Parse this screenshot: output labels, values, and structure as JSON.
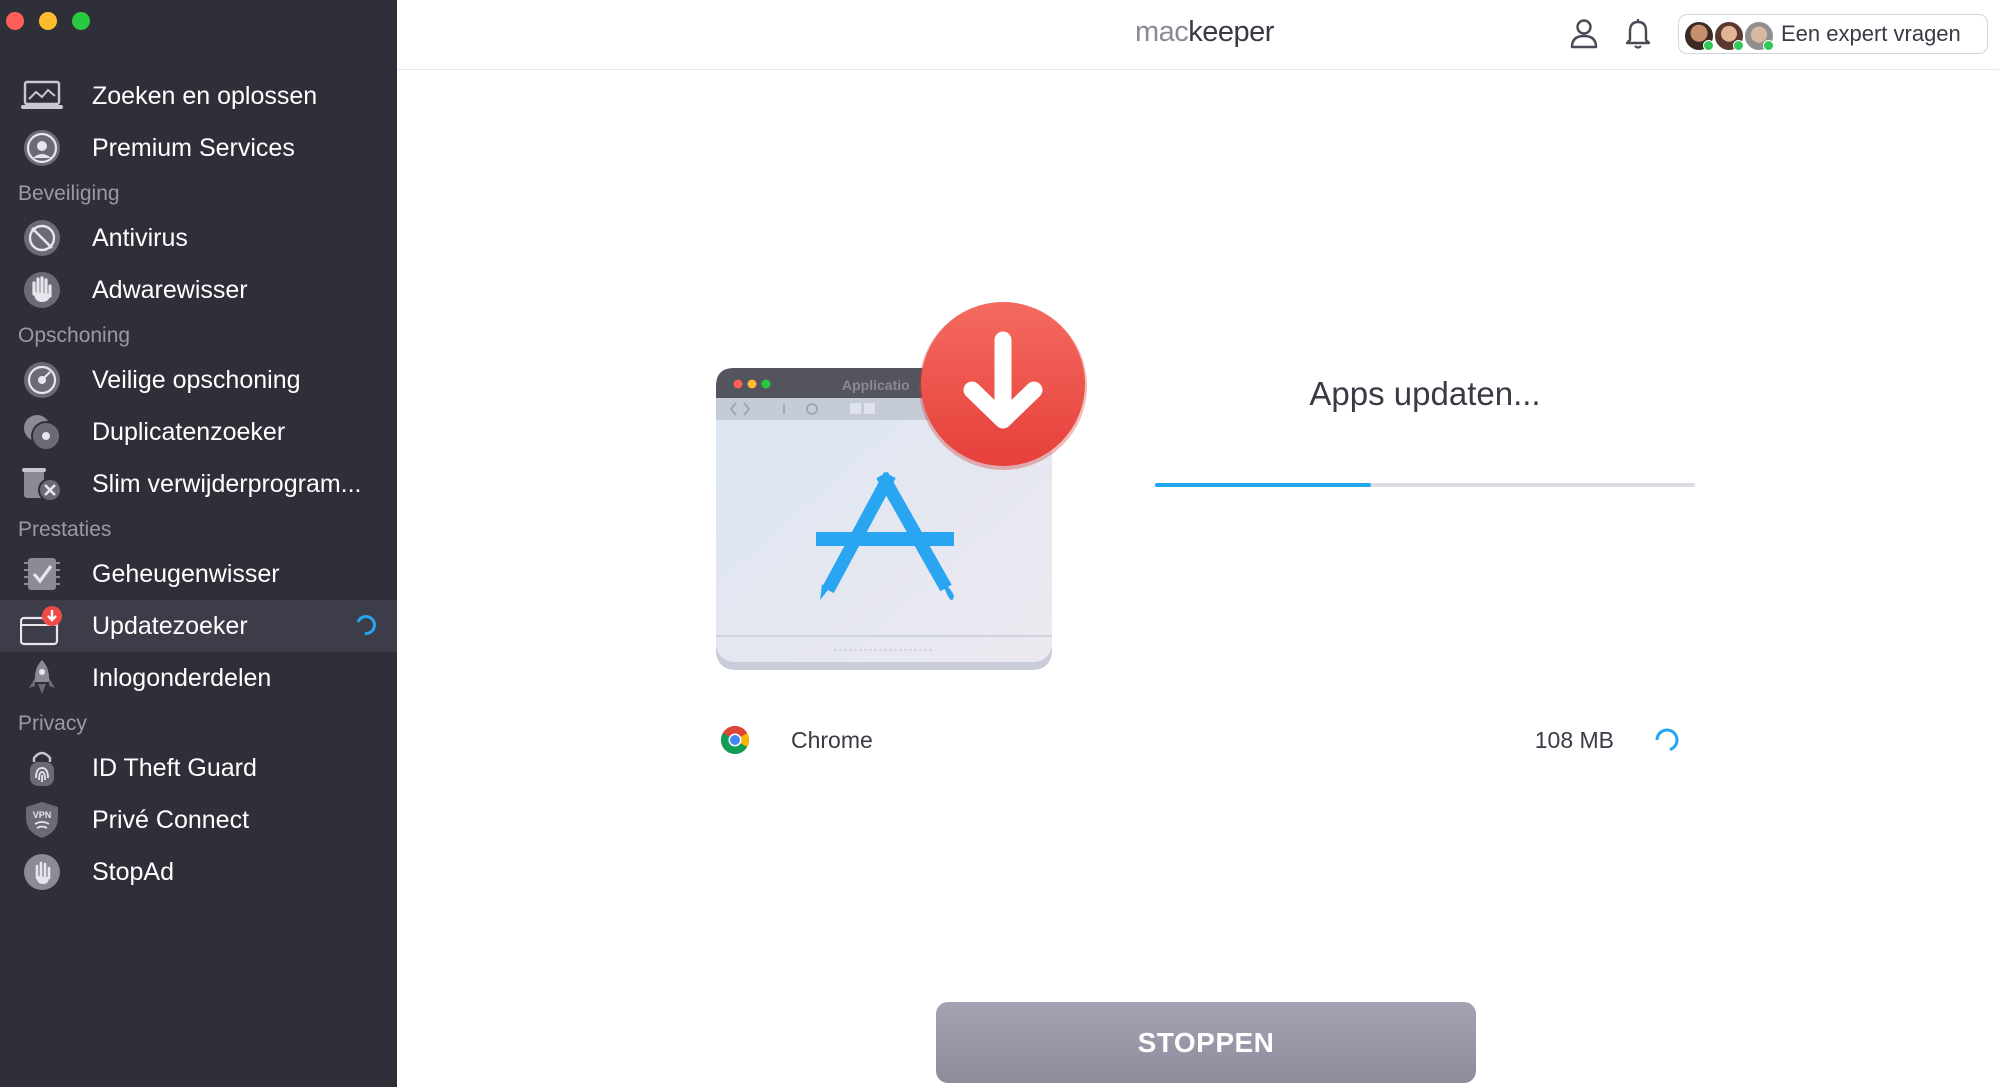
{
  "window": {
    "title": "mackeeper"
  },
  "brand": {
    "prefix": "mac",
    "suffix": "keeper"
  },
  "header": {
    "expert_label": "Een expert vragen"
  },
  "sidebar": {
    "groups": [
      {
        "items": [
          {
            "label": "Zoeken en oplossen",
            "icon": "laptop-icon"
          },
          {
            "label": "Premium Services",
            "icon": "support-agent-icon"
          }
        ]
      },
      {
        "section": "Beveiliging",
        "items": [
          {
            "label": "Antivirus",
            "icon": "antivirus-icon"
          },
          {
            "label": "Adwarewisser",
            "icon": "hand-stop-icon"
          }
        ]
      },
      {
        "section": "Opschoning",
        "items": [
          {
            "label": "Veilige opschoning",
            "icon": "disk-clean-icon"
          },
          {
            "label": "Duplicatenzoeker",
            "icon": "duplicates-icon"
          },
          {
            "label": "Slim verwijderprogram...",
            "icon": "uninstaller-icon"
          }
        ]
      },
      {
        "section": "Prestaties",
        "items": [
          {
            "label": "Geheugenwisser",
            "icon": "memory-icon"
          },
          {
            "label": "Updatezoeker",
            "icon": "update-tracker-icon",
            "active": true
          },
          {
            "label": "Inlogonderdelen",
            "icon": "rocket-icon"
          }
        ]
      },
      {
        "section": "Privacy",
        "items": [
          {
            "label": "ID Theft Guard",
            "icon": "fingerprint-lock-icon"
          },
          {
            "label": "Privé Connect",
            "icon": "vpn-shield-icon"
          },
          {
            "label": "StopAd",
            "icon": "stopad-hand-icon"
          }
        ]
      }
    ]
  },
  "main": {
    "status_title": "Apps updaten...",
    "progress": 0.4,
    "illustration_window_title": "Applicatio",
    "app": {
      "name": "Chrome",
      "size": "108 MB",
      "icon": "chrome-icon"
    },
    "stop_label": "STOPPEN"
  },
  "colors": {
    "sidebar_bg": "#2f2f3a",
    "accent": "#21a6f0",
    "download_badge": "#ef4b45",
    "appstore_blue": "#2aa5f2"
  }
}
